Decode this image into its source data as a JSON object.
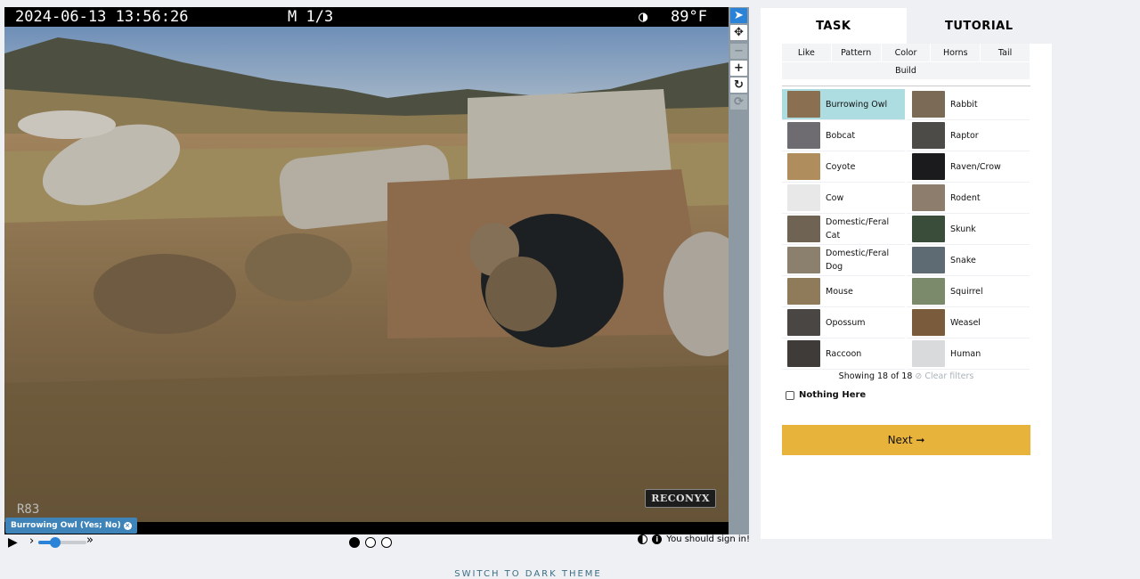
{
  "camera": {
    "datetime": "2024-06-13 13:56:26",
    "frame": "M 1/3",
    "temperature": "89°F",
    "brand": "RECONYX",
    "code": "R83"
  },
  "annotation": {
    "label": "Burrowing Owl (Yes; No)",
    "remove": "×"
  },
  "playback": {
    "play": "▶",
    "slower": "›",
    "faster": "»",
    "speed_fraction": 0.35,
    "frames": 3,
    "current_frame": 1
  },
  "meta": {
    "sign_in": "You should sign in!",
    "info": "i"
  },
  "theme_switch": "SWITCH TO DARK THEME",
  "tabs": {
    "task": "TASK",
    "tutorial": "TUTORIAL"
  },
  "filters": {
    "row1": [
      "Like",
      "Pattern",
      "Color",
      "Horns",
      "Tail"
    ],
    "row2": [
      "Build"
    ]
  },
  "choices": [
    {
      "label": "Burrowing Owl",
      "thumb": "#8a7050",
      "selected": true
    },
    {
      "label": "Rabbit",
      "thumb": "#7b6a55"
    },
    {
      "label": "Bobcat",
      "thumb": "#6e6c70"
    },
    {
      "label": "Raptor",
      "thumb": "#4d4b48"
    },
    {
      "label": "Coyote",
      "thumb": "#b08d5c"
    },
    {
      "label": "Raven/Crow",
      "thumb": "#1b1b1d"
    },
    {
      "label": "Cow",
      "thumb": "#e8e8e8"
    },
    {
      "label": "Rodent",
      "thumb": "#8c7d6c"
    },
    {
      "label": "Domestic/Feral Cat",
      "thumb": "#6f6453"
    },
    {
      "label": "Skunk",
      "thumb": "#3a4c3a"
    },
    {
      "label": "Domestic/Feral Dog",
      "thumb": "#8b7f6e"
    },
    {
      "label": "Snake",
      "thumb": "#5f6b72"
    },
    {
      "label": "Mouse",
      "thumb": "#8f7a5a"
    },
    {
      "label": "Squirrel",
      "thumb": "#7c8a6c"
    },
    {
      "label": "Opossum",
      "thumb": "#4a4644"
    },
    {
      "label": "Weasel",
      "thumb": "#7a5c3c"
    },
    {
      "label": "Raccoon",
      "thumb": "#3e3b38"
    },
    {
      "label": "Human",
      "thumb": "#d9dadc"
    }
  ],
  "showing": {
    "text": "Showing 18 of 18",
    "clear": "⊘ Clear filters"
  },
  "nothing_here": "Nothing Here",
  "next_button": "Next ➞",
  "colors": {
    "accent": "#e8b33b",
    "selected": "#addde1",
    "tool_active": "#2b83d8"
  },
  "tools": [
    {
      "name": "pointer-icon",
      "glyph": "➤",
      "state": "active"
    },
    {
      "name": "move-icon",
      "glyph": "✥",
      "state": "normal"
    },
    {
      "name": "zoom-out-icon",
      "glyph": "−",
      "state": "disabled"
    },
    {
      "name": "zoom-in-icon",
      "glyph": "+",
      "state": "normal"
    },
    {
      "name": "rotate-icon",
      "glyph": "↻",
      "state": "normal"
    },
    {
      "name": "reset-icon",
      "glyph": "⟳",
      "state": "disabled"
    }
  ]
}
